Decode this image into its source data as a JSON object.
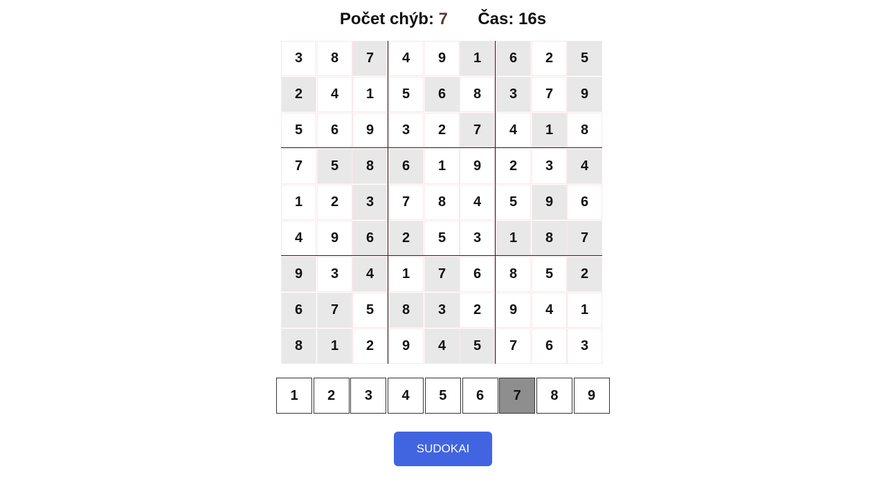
{
  "status": {
    "mistakes_label": "Počet chýb:",
    "mistakes_value": "7",
    "time_label": "Čas:",
    "time_value": "16s"
  },
  "board": {
    "rows": [
      [
        "3",
        "8",
        "7",
        "4",
        "9",
        "1",
        "6",
        "2",
        "5"
      ],
      [
        "2",
        "4",
        "1",
        "5",
        "6",
        "8",
        "3",
        "7",
        "9"
      ],
      [
        "5",
        "6",
        "9",
        "3",
        "2",
        "7",
        "4",
        "1",
        "8"
      ],
      [
        "7",
        "5",
        "8",
        "6",
        "1",
        "9",
        "2",
        "3",
        "4"
      ],
      [
        "1",
        "2",
        "3",
        "7",
        "8",
        "4",
        "5",
        "9",
        "6"
      ],
      [
        "4",
        "9",
        "6",
        "2",
        "5",
        "3",
        "1",
        "8",
        "7"
      ],
      [
        "9",
        "3",
        "4",
        "1",
        "7",
        "6",
        "8",
        "5",
        "2"
      ],
      [
        "6",
        "7",
        "5",
        "8",
        "3",
        "2",
        "9",
        "4",
        "1"
      ],
      [
        "8",
        "1",
        "2",
        "9",
        "4",
        "5",
        "7",
        "6",
        "3"
      ]
    ],
    "given": [
      [
        0,
        0,
        1,
        0,
        0,
        1,
        1,
        0,
        1
      ],
      [
        1,
        0,
        0,
        0,
        1,
        0,
        1,
        0,
        1
      ],
      [
        0,
        0,
        0,
        0,
        0,
        1,
        0,
        1,
        0
      ],
      [
        0,
        1,
        1,
        1,
        0,
        0,
        0,
        0,
        1
      ],
      [
        0,
        0,
        1,
        0,
        0,
        0,
        0,
        1,
        0
      ],
      [
        0,
        0,
        1,
        1,
        0,
        0,
        1,
        1,
        1
      ],
      [
        1,
        0,
        1,
        0,
        1,
        0,
        0,
        0,
        1
      ],
      [
        1,
        1,
        0,
        1,
        1,
        0,
        0,
        0,
        0
      ],
      [
        1,
        1,
        0,
        0,
        1,
        1,
        0,
        0,
        0
      ]
    ]
  },
  "number_pad": {
    "buttons": [
      "1",
      "2",
      "3",
      "4",
      "5",
      "6",
      "7",
      "8",
      "9"
    ],
    "selected": "7"
  },
  "submit_button": {
    "label": "SUDOKAI"
  },
  "colors": {
    "given_cell": "#e8e8e8",
    "cell_border": "#fbe6e9",
    "selected_number": "#8e8e8e",
    "button_blue": "#4164e1",
    "mistake_value": "#5a3a3a"
  }
}
